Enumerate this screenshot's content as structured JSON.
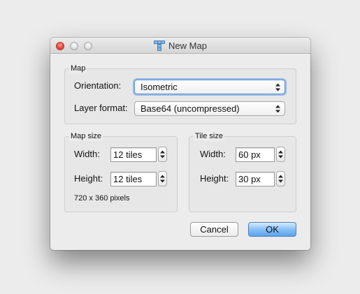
{
  "window": {
    "title": "New Map",
    "icon": "tiled-app-icon"
  },
  "map_group": {
    "label": "Map",
    "orientation_label": "Orientation:",
    "orientation_value": "Isometric",
    "layer_format_label": "Layer format:",
    "layer_format_value": "Base64 (uncompressed)"
  },
  "map_size_group": {
    "label": "Map size",
    "width_label": "Width:",
    "width_value": "12 tiles",
    "height_label": "Height:",
    "height_value": "12 tiles",
    "pixels_note": "720 x 360 pixels"
  },
  "tile_size_group": {
    "label": "Tile size",
    "width_label": "Width:",
    "width_value": "60 px",
    "height_label": "Height:",
    "height_value": "30 px"
  },
  "buttons": {
    "cancel": "Cancel",
    "ok": "OK"
  },
  "colors": {
    "focus_ring": "#5b95d6",
    "default_button": "#5aa3ec",
    "close_button": "#e8483c"
  }
}
